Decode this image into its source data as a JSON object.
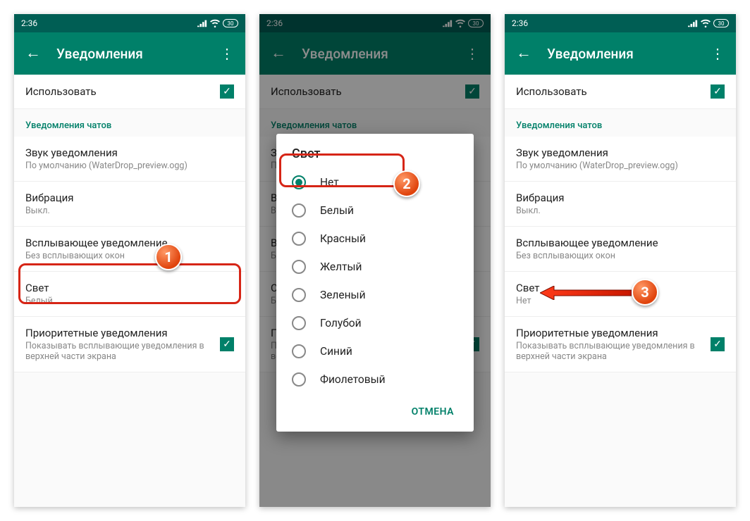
{
  "status": {
    "time": "2:36",
    "battery": "30"
  },
  "appbar": {
    "title": "Уведомления"
  },
  "rows": {
    "use": {
      "title": "Использовать"
    },
    "section_chats": "Уведомления чатов",
    "sound": {
      "title": "Звук уведомления",
      "sub": "По умолчанию (WaterDrop_preview.ogg)"
    },
    "vibration": {
      "title": "Вибрация",
      "sub": "Выкл."
    },
    "popup": {
      "title": "Всплывающее уведомление",
      "sub": "Без всплывающих окон"
    },
    "light_white": {
      "title": "Свет",
      "sub": "Белый"
    },
    "light_none": {
      "title": "Свет",
      "sub": "Нет"
    },
    "priority": {
      "title": "Приоритетные уведомления",
      "sub": "Показывать всплывающие уведомления в верхней части экрана"
    }
  },
  "dialog": {
    "title": "Свет",
    "options": [
      "Нет",
      "Белый",
      "Красный",
      "Желтый",
      "Зеленый",
      "Голубой",
      "Синий",
      "Фиолетовый"
    ],
    "cancel": "ОТМЕНА"
  },
  "callouts": {
    "n1": "1",
    "n2": "2",
    "n3": "3"
  }
}
